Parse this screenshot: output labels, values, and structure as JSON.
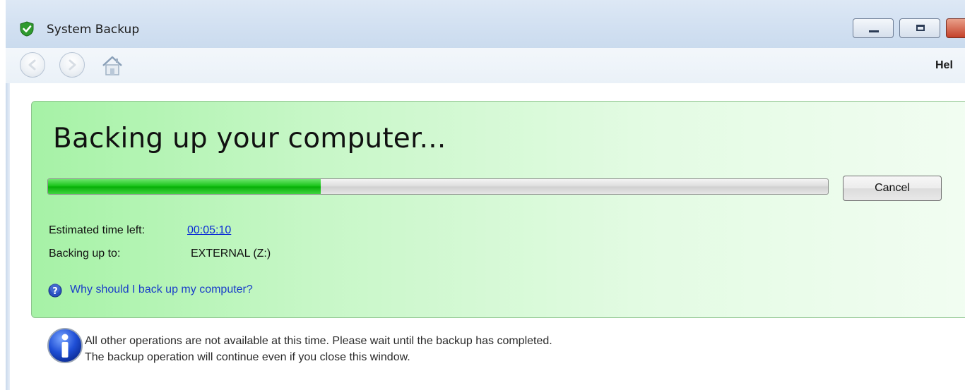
{
  "window": {
    "title": "System Backup",
    "app_icon": "green-shield-check-icon"
  },
  "navbar": {
    "back_icon": "back-arrow-icon",
    "forward_icon": "forward-arrow-icon",
    "home_icon": "home-icon",
    "help_label": "Hel"
  },
  "panel": {
    "heading": "Backing up your computer...",
    "progress_fraction": 0.35,
    "cancel_label": "Cancel",
    "eta_label": "Estimated time left:",
    "eta_value": "00:05:10",
    "destination_label": "Backing up to:",
    "destination_value": "EXTERNAL (Z:)",
    "why_link": "Why should I back up my computer?"
  },
  "info": {
    "line1": "All other operations are not available at this time. Please wait until the backup has completed.",
    "line2": "The backup operation will continue even if you close this window."
  },
  "colors": {
    "panel_accent": "#a6f2a6",
    "progress_fill": "#14c114",
    "link": "#1a3ec9"
  }
}
